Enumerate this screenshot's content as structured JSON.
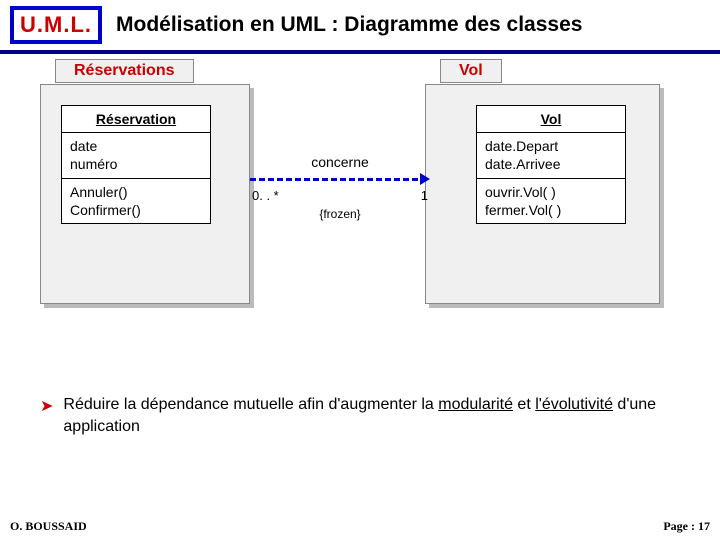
{
  "header": {
    "logo": "U.M.L.",
    "title": "Modélisation en UML : Diagramme des classes"
  },
  "packages": {
    "reservations": {
      "label": "Réservations"
    },
    "vol": {
      "label": "Vol"
    }
  },
  "classes": {
    "reservation": {
      "name": "Réservation",
      "attr1": "date",
      "attr2": "numéro",
      "op1": "Annuler()",
      "op2": "Confirmer()"
    },
    "vol": {
      "name": "Vol",
      "attr1": "date.Depart",
      "attr2": "date.Arrivee",
      "op1": "ouvrir.Vol( )",
      "op2": "fermer.Vol( )"
    }
  },
  "association": {
    "label": "concerne",
    "mult_left": "0. . *",
    "mult_right": "1",
    "constraint": "{frozen}"
  },
  "bullet": {
    "pre": "Réduire la dépendance mutuelle afin d'augmenter la ",
    "u1": "modularité",
    "mid": " et ",
    "u2": "l'évolutivité",
    "post": " d'une application"
  },
  "footer": {
    "author": "O. BOUSSAID",
    "page": "Page : 17"
  }
}
